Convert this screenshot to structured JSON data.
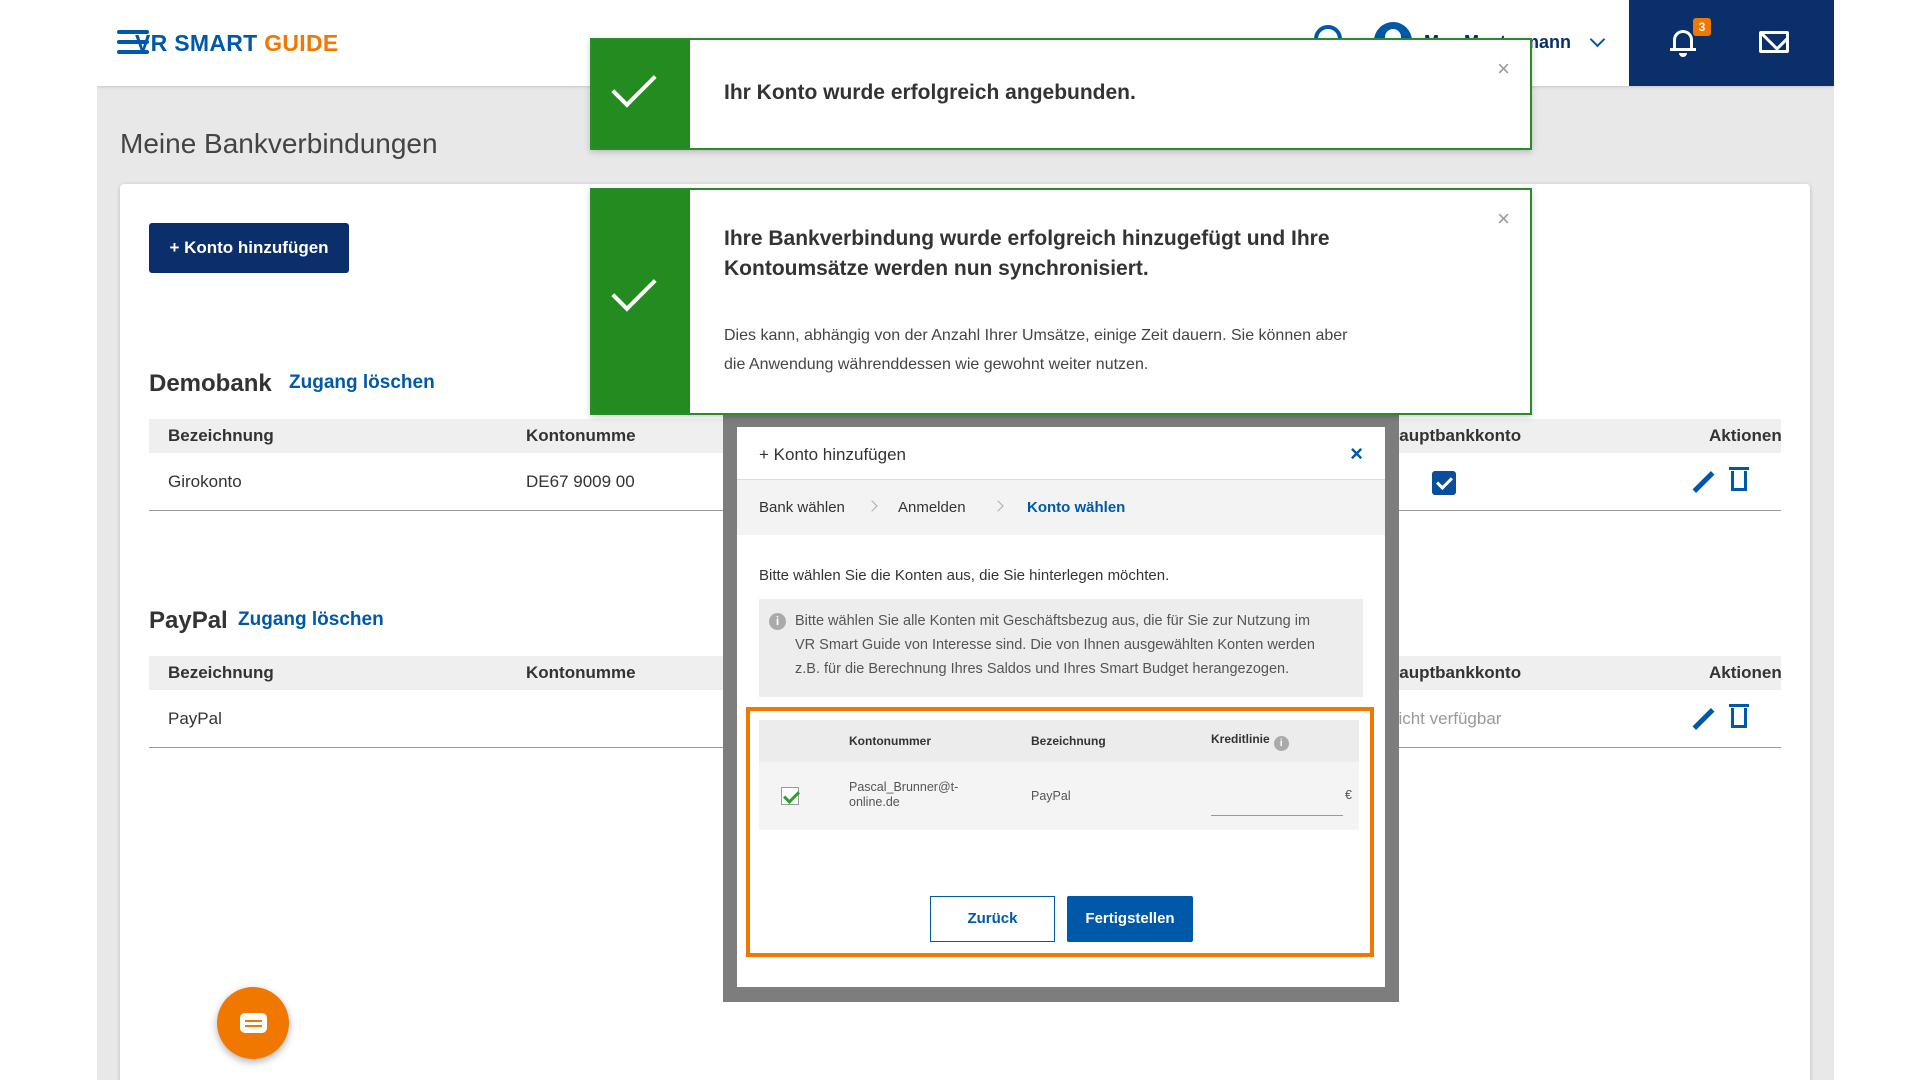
{
  "header": {
    "brand_part1": "VR SMART ",
    "brand_part2": "GUIDE",
    "user_name": "Max Mustermann",
    "notification_count": "3"
  },
  "page_title": "Meine Bankverbindungen",
  "add_account_button": "+ Konto hinzufügen",
  "banks": [
    {
      "name": "Demobank",
      "delete_link": "Zugang löschen",
      "columns": [
        "Bezeichnung",
        "Kontonumme",
        "Hauptbankkonto",
        "Aktionen"
      ],
      "row": {
        "bezeichnung": "Girokonto",
        "kontonummer": "DE67 9009 00",
        "hauptbankkonto": "checked"
      }
    },
    {
      "name": "PayPal",
      "delete_link": "Zugang löschen",
      "columns": [
        "Bezeichnung",
        "Kontonumme",
        "Hauptbankkonto",
        "Aktionen"
      ],
      "row": {
        "bezeichnung": "PayPal",
        "kontonummer": "",
        "hauptbankkonto": "nicht verfügbar"
      }
    }
  ],
  "toasts": [
    {
      "message": "Ihr Konto wurde erfolgreich angebunden.",
      "close": "×"
    },
    {
      "message_line1": "Ihre Bankverbindung wurde erfolgreich hinzugefügt und Ihre",
      "message_line2": "Kontoumsätze werden nun synchronisiert.",
      "sub_line1": "Dies kann, abhängig von der Anzahl Ihrer Umsätze, einige Zeit dauern. Sie können aber",
      "sub_line2": "die Anwendung währenddessen wie gewohnt weiter nutzen.",
      "close": "×"
    }
  ],
  "modal": {
    "title": "+ Konto hinzufügen",
    "close": "×",
    "steps": [
      "Bank wählen",
      "Anmelden",
      "Konto wählen"
    ],
    "instruction": "Bitte wählen Sie die Konten aus, die Sie hinterlegen möchten.",
    "info_line1": "Bitte wählen Sie alle Konten mit Geschäftsbezug aus, die für Sie zur Nutzung im",
    "info_line2": "VR Smart Guide von Interesse sind. Die von Ihnen ausgewählten Konten werden",
    "info_line3": "z.B. für die Berechnung Ihres Saldos und Ihres Smart Budget herangezogen.",
    "table_headers": [
      "Kontonummer",
      "Bezeichnung",
      "Kreditlinie"
    ],
    "account": {
      "kontonummer_l1": "Pascal_Brunner@t-",
      "kontonummer_l2": "online.de",
      "bezeichnung": "PayPal",
      "currency": "€"
    },
    "back_button": "Zurück",
    "finish_button": "Fertigstellen"
  },
  "colors": {
    "navy": "#0a2f6b",
    "blue": "#0059a8",
    "orange": "#f07800",
    "green": "#238b1f"
  }
}
